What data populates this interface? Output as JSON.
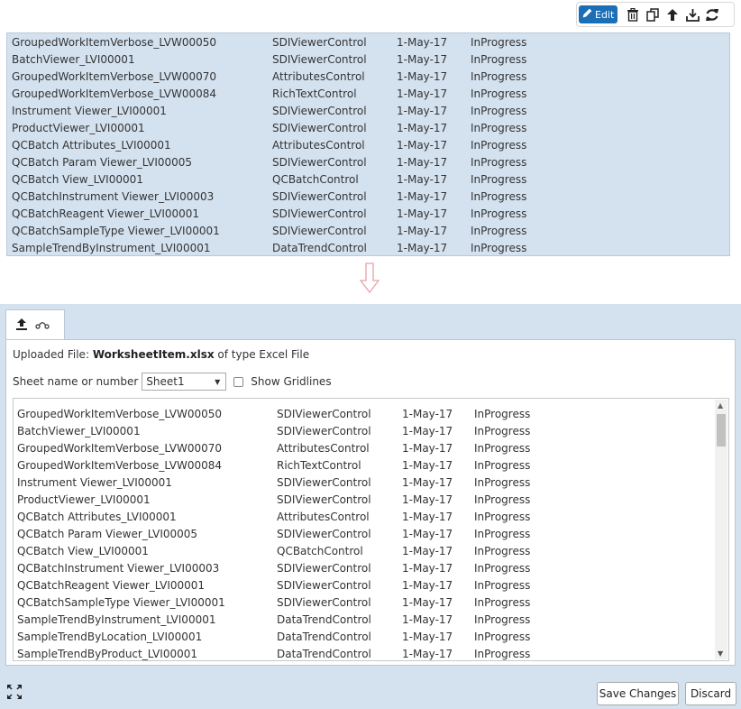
{
  "toolbar": {
    "edit_label": "Edit",
    "icons": [
      "pencil-icon",
      "trash-icon",
      "copy-icon",
      "arrow-up-icon",
      "download-icon",
      "refresh-icon"
    ]
  },
  "top_rows": [
    [
      "GroupedWorkItemVerbose_LVW00050",
      "SDIViewerControl",
      "1-May-17",
      "InProgress"
    ],
    [
      "BatchViewer_LVI00001",
      "SDIViewerControl",
      "1-May-17",
      "InProgress"
    ],
    [
      "GroupedWorkItemVerbose_LVW00070",
      "AttributesControl",
      "1-May-17",
      "InProgress"
    ],
    [
      "GroupedWorkItemVerbose_LVW00084",
      "RichTextControl",
      "1-May-17",
      "InProgress"
    ],
    [
      "Instrument Viewer_LVI00001",
      "SDIViewerControl",
      "1-May-17",
      "InProgress"
    ],
    [
      "ProductViewer_LVI00001",
      "SDIViewerControl",
      "1-May-17",
      "InProgress"
    ],
    [
      "QCBatch Attributes_LVI00001",
      "AttributesControl",
      "1-May-17",
      "InProgress"
    ],
    [
      "QCBatch Param Viewer_LVI00005",
      "SDIViewerControl",
      "1-May-17",
      "InProgress"
    ],
    [
      "QCBatch View_LVI00001",
      "QCBatchControl",
      "1-May-17",
      "InProgress"
    ],
    [
      "QCBatchInstrument Viewer_LVI00003",
      "SDIViewerControl",
      "1-May-17",
      "InProgress"
    ],
    [
      "QCBatchReagent Viewer_LVI00001",
      "SDIViewerControl",
      "1-May-17",
      "InProgress"
    ],
    [
      "QCBatchSampleType Viewer_LVI00001",
      "SDIViewerControl",
      "1-May-17",
      "InProgress"
    ],
    [
      "SampleTrendByInstrument_LVI00001",
      "DataTrendControl",
      "1-May-17",
      "InProgress"
    ]
  ],
  "panel": {
    "tabs": [
      "upload-icon",
      "link-icon"
    ],
    "uploaded_prefix": "Uploaded File: ",
    "uploaded_file": "WorksheetItem.xlsx",
    "uploaded_suffix": " of type Excel File",
    "sheet_label": "Sheet name or number",
    "sheet_value": "Sheet1",
    "gridlines_label": "Show Gridlines",
    "gridlines_checked": false,
    "save_label": "Save Changes",
    "discard_label": "Discard"
  },
  "bottom_rows": [
    [
      "GroupedWorkItemVerbose_LVW00050",
      "SDIViewerControl",
      "1-May-17",
      "InProgress"
    ],
    [
      "BatchViewer_LVI00001",
      "SDIViewerControl",
      "1-May-17",
      "InProgress"
    ],
    [
      "GroupedWorkItemVerbose_LVW00070",
      "AttributesControl",
      "1-May-17",
      "InProgress"
    ],
    [
      "GroupedWorkItemVerbose_LVW00084",
      "RichTextControl",
      "1-May-17",
      "InProgress"
    ],
    [
      "Instrument Viewer_LVI00001",
      "SDIViewerControl",
      "1-May-17",
      "InProgress"
    ],
    [
      "ProductViewer_LVI00001",
      "SDIViewerControl",
      "1-May-17",
      "InProgress"
    ],
    [
      "QCBatch Attributes_LVI00001",
      "AttributesControl",
      "1-May-17",
      "InProgress"
    ],
    [
      "QCBatch Param Viewer_LVI00005",
      "SDIViewerControl",
      "1-May-17",
      "InProgress"
    ],
    [
      "QCBatch View_LVI00001",
      "QCBatchControl",
      "1-May-17",
      "InProgress"
    ],
    [
      "QCBatchInstrument Viewer_LVI00003",
      "SDIViewerControl",
      "1-May-17",
      "InProgress"
    ],
    [
      "QCBatchReagent Viewer_LVI00001",
      "SDIViewerControl",
      "1-May-17",
      "InProgress"
    ],
    [
      "QCBatchSampleType Viewer_LVI00001",
      "SDIViewerControl",
      "1-May-17",
      "InProgress"
    ],
    [
      "SampleTrendByInstrument_LVI00001",
      "DataTrendControl",
      "1-May-17",
      "InProgress"
    ],
    [
      "SampleTrendByLocation_LVI00001",
      "DataTrendControl",
      "1-May-17",
      "InProgress"
    ],
    [
      "SampleTrendByProduct_LVI00001",
      "DataTrendControl",
      "1-May-17",
      "InProgress"
    ]
  ],
  "colors": {
    "accent": "#1c6fb5",
    "panel_bg": "#d4e2f0",
    "arrow": "#e8a0a8"
  }
}
